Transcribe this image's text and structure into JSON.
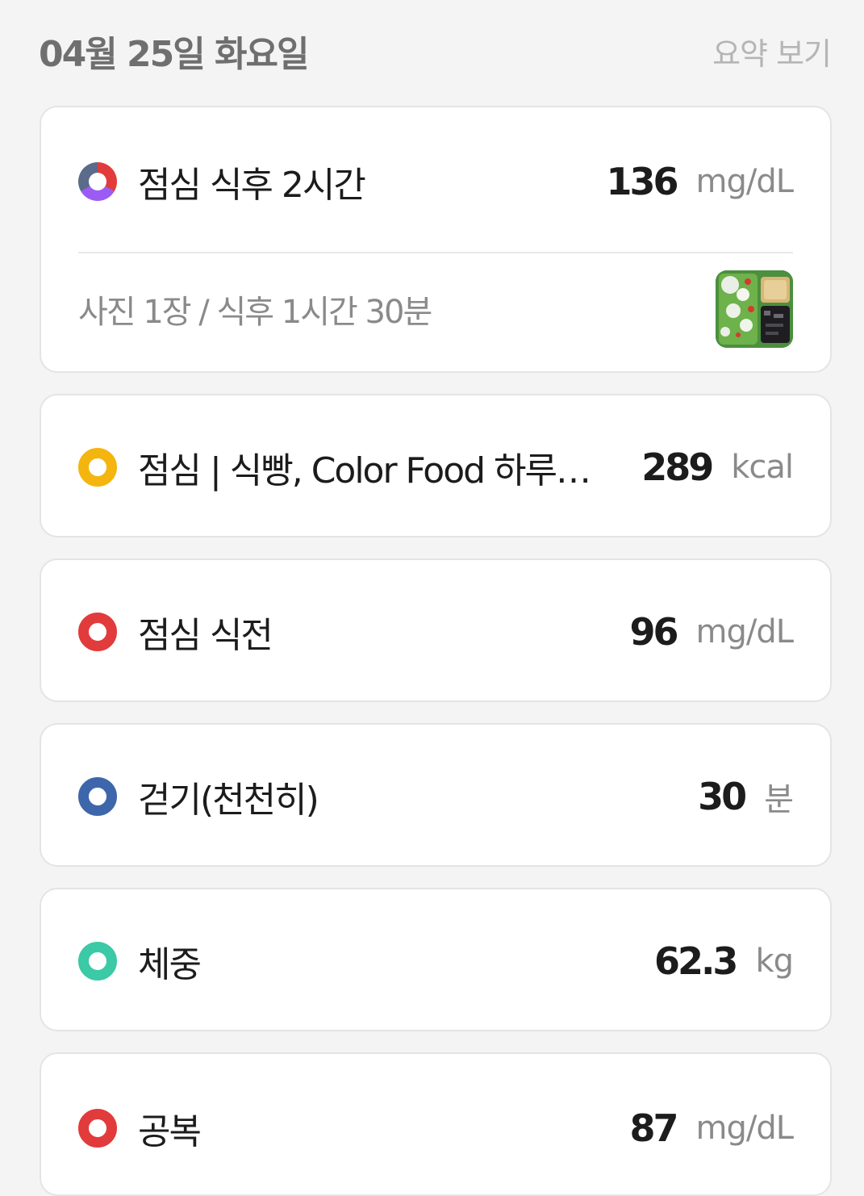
{
  "header": {
    "date": "04월 25일 화요일",
    "summary_link": "요약 보기"
  },
  "entries": [
    {
      "label": "점심 식후 2시간",
      "value": "136",
      "unit": "mg/dL",
      "photo_info": "사진 1장 / 식후 1시간 30분",
      "dot_colors": [
        "#e23b3b",
        "#9b5cf5",
        "#5b6b8a"
      ]
    },
    {
      "label": "점심 | 식빵, Color Food 하루…",
      "value": "289",
      "unit": "kcal",
      "dot_color": "#f5b50f"
    },
    {
      "label": "점심 식전",
      "value": "96",
      "unit": "mg/dL",
      "dot_color": "#e23b3b"
    },
    {
      "label": "걷기(천천히)",
      "value": "30",
      "unit": "분",
      "dot_color": "#3e67ab"
    },
    {
      "label": "체중",
      "value": "62.3",
      "unit": "kg",
      "dot_color": "#3cc9a5"
    },
    {
      "label": "공복",
      "value": "87",
      "unit": "mg/dL",
      "dot_color": "#e23b3b"
    }
  ]
}
